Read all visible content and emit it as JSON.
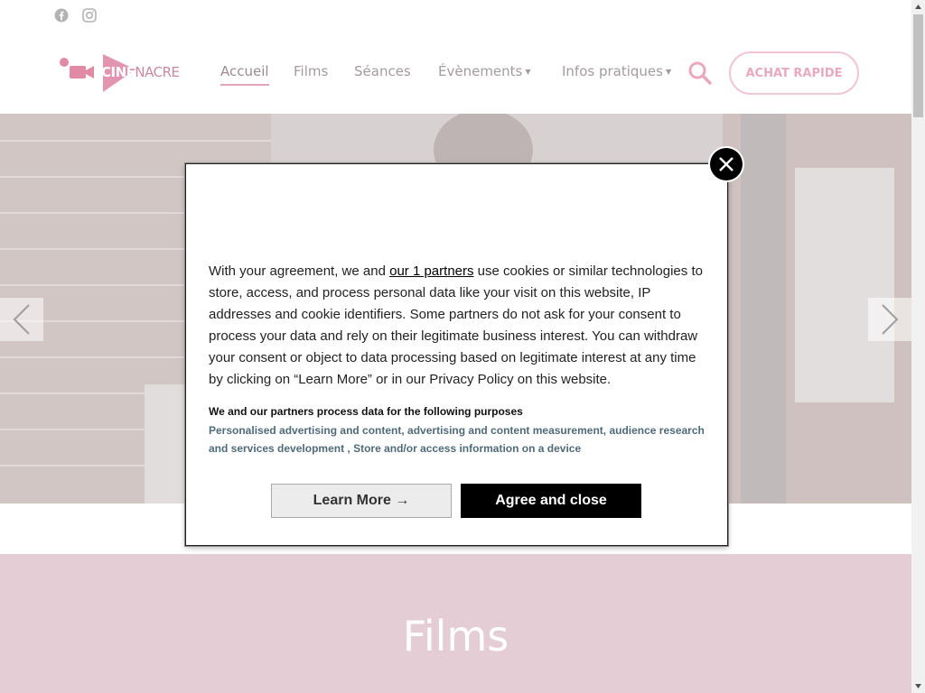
{
  "header": {
    "social": [
      {
        "icon": "facebook-icon"
      },
      {
        "icon": "instagram-icon"
      }
    ],
    "logo": {
      "part1": "CINE",
      "part2": "NACRE"
    },
    "nav": [
      {
        "label": "Accueil",
        "active": true
      },
      {
        "label": "Films"
      },
      {
        "label": "Séances"
      },
      {
        "label": "Évènements",
        "dropdown": true
      },
      {
        "label": "Infos pratiques",
        "dropdown": true
      }
    ],
    "search_icon": "search-icon",
    "cta_label": "ACHAT RAPIDE"
  },
  "section": {
    "title": "Films"
  },
  "consent": {
    "text_before_link": "With your agreement, we and ",
    "link_text": "our 1 partners",
    "text_after_link": " use cookies or similar technologies to store, access, and process personal data like your visit on this website, IP addresses and cookie identifiers. Some partners do not ask for your consent to process your data and rely on their legitimate business interest. You can withdraw your consent or object to data processing based on legitimate interest at any time by clicking on “Learn More” or in our Privacy Policy on this website.",
    "purposes_title": "We and our partners process data for the following purposes",
    "purposes_text": "Personalised advertising and content, advertising and content measurement, audience research and services development , Store and/or access information on a device",
    "learn_more_label": "Learn More →",
    "agree_label": "Agree and close"
  },
  "colors": {
    "brand_pink": "#e08aa6",
    "films_band": "#e5cdd5",
    "purpose_text": "#4f6b7a"
  }
}
